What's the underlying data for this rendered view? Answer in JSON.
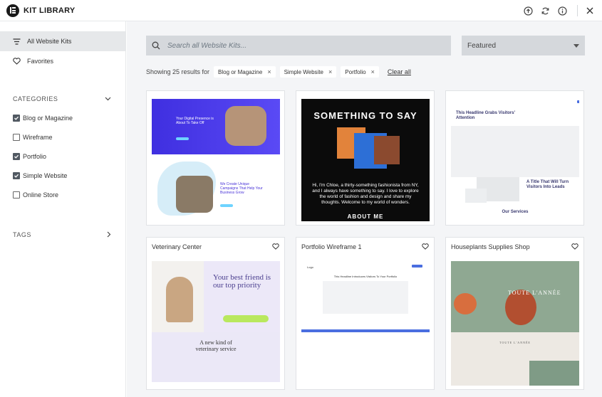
{
  "app": {
    "title": "KIT LIBRARY"
  },
  "colors": {
    "accent": "#515962",
    "search_bg": "#d5d8dc",
    "main_bg": "#f4f5f7"
  },
  "sidebar": {
    "items": [
      {
        "label": "All Website Kits",
        "icon": "filter-icon",
        "active": true
      },
      {
        "label": "Favorites",
        "icon": "heart-icon",
        "active": false
      }
    ],
    "categories": {
      "title": "CATEGORIES",
      "options": [
        {
          "label": "Blog or Magazine",
          "checked": true
        },
        {
          "label": "Wireframe",
          "checked": false
        },
        {
          "label": "Portfolio",
          "checked": true
        },
        {
          "label": "Simple Website",
          "checked": true
        },
        {
          "label": "Online Store",
          "checked": false
        }
      ]
    },
    "tags": {
      "title": "TAGS"
    }
  },
  "search": {
    "placeholder": "Search all Website Kits..."
  },
  "sort": {
    "selected": "Featured"
  },
  "results": {
    "summary": "Showing 25 results for",
    "chips": [
      "Blog or Magazine",
      "Simple Website",
      "Portfolio"
    ],
    "clear_label": "Clear all"
  },
  "cards": {
    "row2": [
      {
        "title": "Veterinary Center"
      },
      {
        "title": "Portfolio Wireframe 1"
      },
      {
        "title": "Houseplants Supplies Shop"
      }
    ]
  },
  "thumbs": {
    "t1": {
      "hero": "Your Digital Presence is About To Take Off",
      "section": "We Create Unique Campaigns That Help Your Business Grow"
    },
    "t2": {
      "headline": "SOMETHING TO SAY",
      "bio": "Hi, I'm Chloe, a thirty-something fashionista from NY, and I always have something to say. I love to explore the world of fashion and design and share my thoughts. Welcome to my world of wonders.",
      "about": "ABOUT ME"
    },
    "t3": {
      "headline": "This Headline Grabs Visitors' Attention",
      "title2": "A Title That Will Turn Visitors Into Leads",
      "services": "Our Services"
    },
    "t4": {
      "headline": "Your best friend is our top priority",
      "sub": "A new kind of veterinary service"
    },
    "t5": {
      "logo": "Logo",
      "headline": "This Headline Introduces Visitors To Your Portfolio"
    },
    "t6": {
      "title": "TOUTE L'ANNÉE",
      "footer_title": "TOUTE L'ANNÉE"
    }
  }
}
